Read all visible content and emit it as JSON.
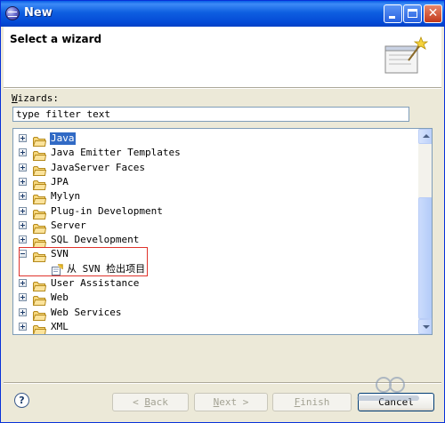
{
  "window": {
    "title": "New"
  },
  "header": {
    "title": "Select a wizard"
  },
  "filter": {
    "label_prefix": "W",
    "label_rest": "izards:",
    "value": "type filter text"
  },
  "tree": {
    "items": [
      {
        "label": "Java",
        "expanded": false,
        "selected": true
      },
      {
        "label": "Java Emitter Templates",
        "expanded": false
      },
      {
        "label": "JavaServer Faces",
        "expanded": false
      },
      {
        "label": "JPA",
        "expanded": false
      },
      {
        "label": "Mylyn",
        "expanded": false
      },
      {
        "label": "Plug-in Development",
        "expanded": false
      },
      {
        "label": "Server",
        "expanded": false
      },
      {
        "label": "SQL Development",
        "expanded": false
      },
      {
        "label": "SVN",
        "expanded": true
      },
      {
        "label": "从 SVN 检出项目",
        "child": true
      },
      {
        "label": "User Assistance",
        "expanded": false
      },
      {
        "label": "Web",
        "expanded": false
      },
      {
        "label": "Web Services",
        "expanded": false
      },
      {
        "label": "XML",
        "expanded": false
      }
    ]
  },
  "buttons": {
    "help": "?",
    "back_arrow": "< ",
    "back_key": "B",
    "back_rest": "ack",
    "next_key": "N",
    "next_rest": "ext >",
    "finish_key": "F",
    "finish_rest": "inish",
    "cancel": "Cancel"
  },
  "colors": {
    "selection": "#316ac5",
    "highlight_box": "#e0332c",
    "titlebar": "#0349d6"
  }
}
